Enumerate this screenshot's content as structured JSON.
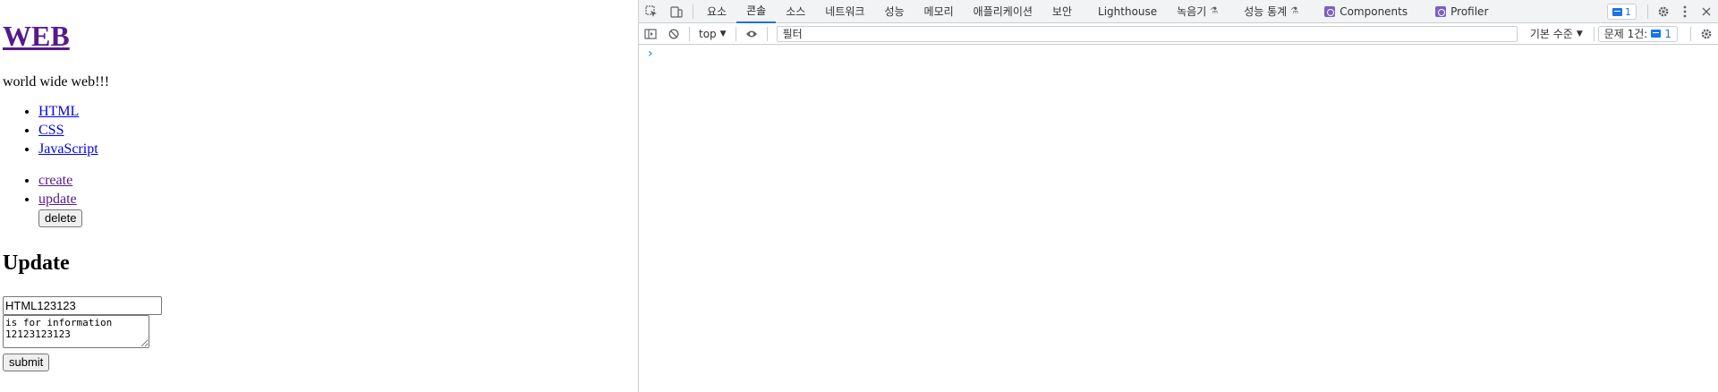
{
  "page": {
    "heading": "WEB",
    "description": "world wide web!!!",
    "topics": [
      "HTML",
      "CSS",
      "JavaScript"
    ],
    "controls": {
      "create": "create",
      "update": "update",
      "delete": "delete"
    },
    "form_heading": "Update",
    "form": {
      "title_value": "HTML123123",
      "description_value": "is for information\n12123123123",
      "submit_label": "submit"
    }
  },
  "devtools": {
    "tabs": [
      "요소",
      "콘솔",
      "소스",
      "네트워크",
      "성능",
      "메모리",
      "애플리케이션",
      "보안",
      "Lighthouse",
      "녹음기",
      "성능 통계",
      "Components",
      "Profiler"
    ],
    "active_tab": "콘솔",
    "issue_badge_count": "1",
    "toolbar": {
      "context": "top",
      "filter_placeholder": "필터",
      "log_level": "기본 수준",
      "issues_label": "문제 1건:",
      "issues_count": "1"
    },
    "accent_color": "#1a73e8"
  }
}
